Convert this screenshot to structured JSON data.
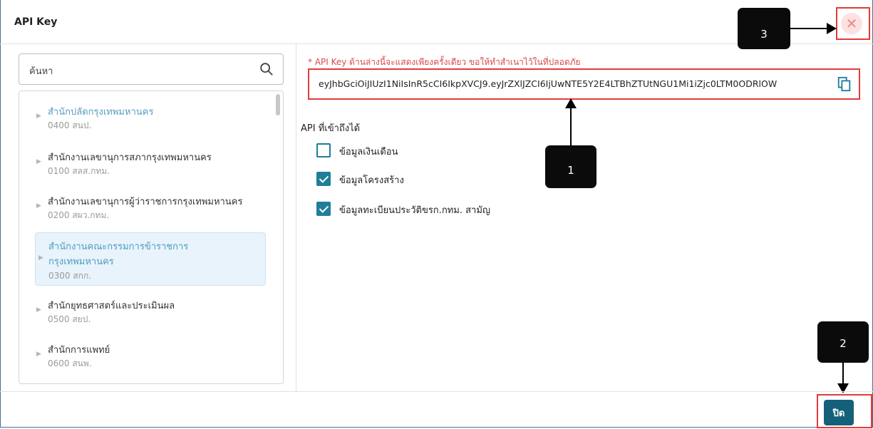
{
  "dialog": {
    "title": "API Key",
    "close_symbol": "✕",
    "footer_button": "ปิด"
  },
  "search": {
    "value": "ค้นหา"
  },
  "tree": {
    "items": [
      {
        "name": "สำนักปลัดกรุงเทพมหานคร",
        "code": "0400 สนป.",
        "state": "active"
      },
      {
        "name": "สำนักงานเลขานุการสภากรุงเทพมหานคร",
        "code": "0100 สลส.กทม.",
        "state": "normal"
      },
      {
        "name": "สำนักงานเลขานุการผู้ว่าราชการกรุงเทพมหานคร",
        "code": "0200 สผว.กทม.",
        "state": "normal"
      },
      {
        "name_line1": "สำนักงานคณะกรรมการข้าราชการ",
        "name_line2": "กรุงเทพมหานคร",
        "code": "0300 สกก.",
        "state": "selected"
      },
      {
        "name": "สำนักยุทธศาสตร์และประเมินผล",
        "code": "0500 สยป.",
        "state": "normal"
      },
      {
        "name": "สำนักการแพทย์",
        "code": "0600 สนพ.",
        "state": "normal"
      }
    ]
  },
  "api_key": {
    "warning": "* API Key ด้านล่างนี้จะแสดงเพียงครั้งเดียว ขอให้ทำสำเนาไว้ในที่ปลอดภัย",
    "value": "eyJhbGciOiJIUzI1NiIsInR5cCI6IkpXVCJ9.eyJrZXlJZCI6IjUwNTE5Y2E4LTBhZTUtNGU1Mi1iZjc0LTM0ODRlOW"
  },
  "access": {
    "label": "API ที่เข้าถึงได้",
    "options": [
      {
        "label": "ข้อมูลเงินเดือน",
        "checked": false
      },
      {
        "label": "ข้อมูลโครงสร้าง",
        "checked": true
      },
      {
        "label": "ข้อมูลทะเบียนประวัติขรก.กทม. สามัญ",
        "checked": true
      }
    ]
  },
  "callouts": [
    "1",
    "2",
    "3"
  ],
  "colors": {
    "accent": "#1f7e9a",
    "button": "#14607b",
    "highlight": "#e23b3b",
    "warning": "#d94a4a"
  }
}
